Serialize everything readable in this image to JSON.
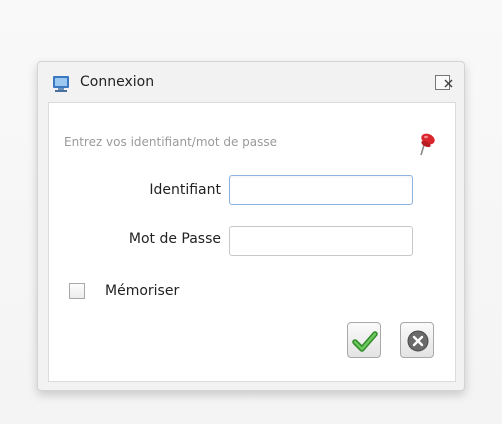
{
  "dialog": {
    "title": "Connexion",
    "title_icon": "monitor-icon",
    "close_icon": "close-icon"
  },
  "form": {
    "hint": "Entrez vos identifiant/mot de passe",
    "pin_icon": "pushpin-icon",
    "identifiant_label": "Identifiant",
    "identifiant_value": "",
    "password_label": "Mot de Passe",
    "password_value": "",
    "remember_label": "Mémoriser",
    "remember_checked": false
  },
  "actions": {
    "ok_icon": "checkmark-icon",
    "cancel_icon": "cancel-circle-icon"
  },
  "colors": {
    "ok_green": "#3f9f35",
    "cancel_grey": "#6a6a6a",
    "focus_border": "#8fb3dc"
  }
}
